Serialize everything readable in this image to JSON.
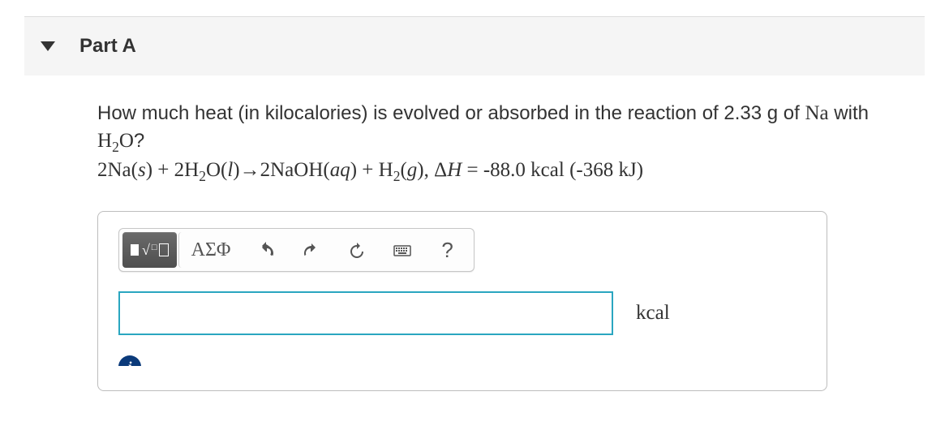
{
  "part": {
    "title": "Part A"
  },
  "question": {
    "prompt": "How much heat (in kilocalories) is evolved or absorbed in the reaction of 2.33 g of ",
    "prompt_inline_1": "Na",
    "prompt_inline_2": " with ",
    "prompt_inline_3": "H",
    "prompt_inline_3_sub": "2",
    "prompt_inline_4": "O",
    "prompt_inline_5": "?",
    "equation": {
      "lhs1": "2Na(",
      "lhs1_state": "s",
      "lhs1_close": ") + 2H",
      "lhs1_sub": "2",
      "lhs2": "O(",
      "lhs2_state": "l",
      "lhs2_close": ")",
      "arrow": "→",
      "rhs1": "2NaOH(",
      "rhs1_state": "aq",
      "rhs1_close": ") + H",
      "rhs1_sub": "2",
      "rhs2": "(",
      "rhs2_state": "g",
      "rhs2_close": "), Δ",
      "dH": "H",
      "eq": " = ",
      "value": "-88.0 kcal (-368 kJ)"
    }
  },
  "toolbar": {
    "greek_label": "ΑΣΦ",
    "help_label": "?"
  },
  "answer": {
    "value": "",
    "unit": "kcal"
  }
}
